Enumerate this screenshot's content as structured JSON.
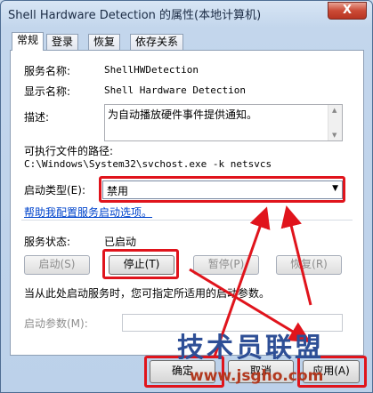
{
  "window": {
    "title": "Shell Hardware Detection 的属性(本地计算机)",
    "close_label": "X"
  },
  "tabs": [
    {
      "label": "常规",
      "active": true
    },
    {
      "label": "登录",
      "active": false
    },
    {
      "label": "恢复",
      "active": false
    },
    {
      "label": "依存关系",
      "active": false
    }
  ],
  "general": {
    "service_name_label": "服务名称:",
    "service_name_value": "ShellHWDetection",
    "display_name_label": "显示名称:",
    "display_name_value": "Shell Hardware Detection",
    "description_label": "描述:",
    "description_value": "为自动播放硬件事件提供通知。",
    "exe_path_label": "可执行文件的路径:",
    "exe_path_value": "C:\\Windows\\System32\\svchost.exe -k netsvcs",
    "startup_type_label": "启动类型(E):",
    "startup_type_value": "禁用",
    "help_link": "帮助我配置服务启动选项。",
    "status_label": "服务状态:",
    "status_value": "已启动",
    "start_button": "启动(S)",
    "stop_button": "停止(T)",
    "pause_button": "暂停(P)",
    "resume_button": "恢复(R)",
    "start_hint": "当从此处启动服务时，您可指定所适用的启动参数。",
    "start_params_label": "启动参数(M):",
    "start_params_value": ""
  },
  "footer": {
    "ok_button": "确定",
    "cancel_button": "取消",
    "apply_button": "应用(A)"
  },
  "watermark": {
    "text": "技术员联盟",
    "url": "www.jsgho.com"
  },
  "colors": {
    "highlight_red": "#e0141c",
    "link_blue": "#0044cc"
  }
}
